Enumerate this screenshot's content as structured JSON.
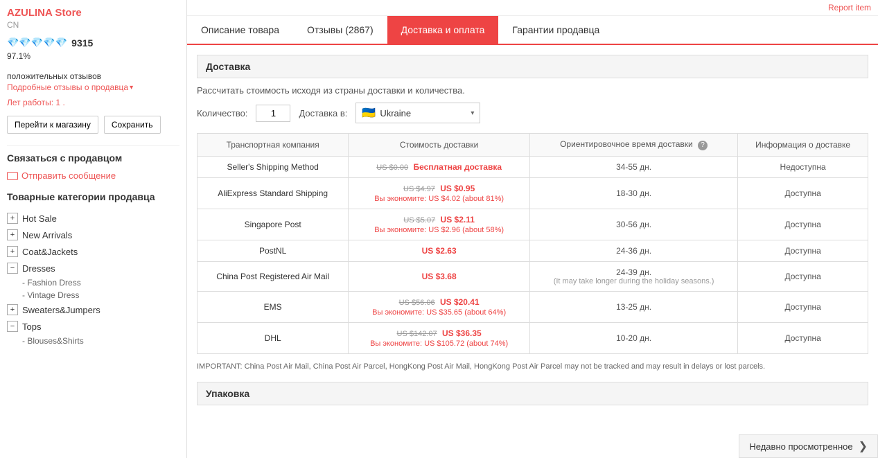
{
  "report": {
    "label": "Report item"
  },
  "sidebar": {
    "store_name": "AZULINA Store",
    "store_country": "CN",
    "diamonds": "💎💎💎💎💎",
    "rating_score": "9315",
    "positive_pct": "97.1%",
    "positive_label": "положительных отзывов",
    "reviews_link": "Подробные отзывы о продавца",
    "years_label": "Лет работы:",
    "years_value": "1",
    "years_dot": " .",
    "btn_shop": "Перейти к магазину",
    "btn_save": "Сохранить",
    "contact_title": "Связаться с продавцом",
    "send_msg": "Отправить сообщение",
    "categories_title": "Товарные категории продавца",
    "categories": [
      {
        "id": "hot-sale",
        "label": "Hot Sale",
        "expanded": false
      },
      {
        "id": "new-arrivals",
        "label": "New Arrivals",
        "expanded": false
      },
      {
        "id": "coat-jackets",
        "label": "Coat&Jackets",
        "expanded": false
      },
      {
        "id": "dresses",
        "label": "Dresses",
        "expanded": true,
        "children": [
          {
            "id": "fashion-dress",
            "label": "Fashion Dress"
          },
          {
            "id": "vintage-dress",
            "label": "Vintage Dress"
          }
        ]
      },
      {
        "id": "sweaters-jumpers",
        "label": "Sweaters&Jumpers",
        "expanded": false
      },
      {
        "id": "tops",
        "label": "Tops",
        "expanded": true,
        "children": [
          {
            "id": "blouses-shirts",
            "label": "Blouses&Shirts"
          }
        ]
      }
    ]
  },
  "tabs": [
    {
      "id": "description",
      "label": "Описание товара"
    },
    {
      "id": "reviews",
      "label": "Отзывы (2867)"
    },
    {
      "id": "delivery",
      "label": "Доставка и оплата",
      "active": true
    },
    {
      "id": "guarantees",
      "label": "Гарантии продавца"
    }
  ],
  "delivery": {
    "section_title": "Доставка",
    "calc_desc": "Рассчитать стоимость исходя из страны доставки и количества.",
    "qty_label": "Количество:",
    "qty_value": "1",
    "dest_label": "Доставка в:",
    "dest_country": "Ukraine",
    "table_headers": [
      "Транспортная компания",
      "Стоимость доставки",
      "Ориентировочное время доставки",
      "Информация о доставке"
    ],
    "rows": [
      {
        "method": "Seller's Shipping Method",
        "price_old": "US $0.00",
        "price_new": "Бесплатная доставка",
        "price_save": null,
        "is_free": true,
        "days": "34-55 дн.",
        "availability": "Недоступна"
      },
      {
        "method": "AliExpress Standard Shipping",
        "price_old": "US $4.97",
        "price_new": "US $0.95",
        "price_save": "Вы экономите: US $4.02 (about 81%)",
        "is_free": false,
        "days": "18-30 дн.",
        "availability": "Доступна"
      },
      {
        "method": "Singapore Post",
        "price_old": "US $5.07",
        "price_new": "US $2.11",
        "price_save": "Вы экономите: US $2.96 (about 58%)",
        "is_free": false,
        "days": "30-56 дн.",
        "availability": "Доступна"
      },
      {
        "method": "PostNL",
        "price_old": null,
        "price_new": "US $2.63",
        "price_save": null,
        "is_free": false,
        "days": "24-36 дн.",
        "availability": "Доступна"
      },
      {
        "method": "China Post Registered Air Mail",
        "price_old": null,
        "price_new": "US $3.68",
        "price_save": null,
        "is_free": false,
        "days": "24-39 дн.",
        "days_note": "(It may take longer during the holiday seasons.)",
        "availability": "Доступна"
      },
      {
        "method": "EMS",
        "price_old": "US $56.06",
        "price_new": "US $20.41",
        "price_save": "Вы экономите: US $35.65 (about 64%)",
        "is_free": false,
        "days": "13-25 дн.",
        "availability": "Доступна"
      },
      {
        "method": "DHL",
        "price_old": "US $142.07",
        "price_new": "US $36.35",
        "price_save": "Вы экономите: US $105.72 (about 74%)",
        "is_free": false,
        "days": "10-20 дн.",
        "availability": "Доступна"
      }
    ],
    "important_note": "IMPORTANT: China Post Air Mail, China Post Air Parcel, HongKong Post Air Mail, HongKong Post Air Parcel may not be tracked and may result in delays or lost parcels.",
    "packaging_title": "Упаковка"
  },
  "recently_viewed": {
    "label": "Недавно просмотренное"
  }
}
